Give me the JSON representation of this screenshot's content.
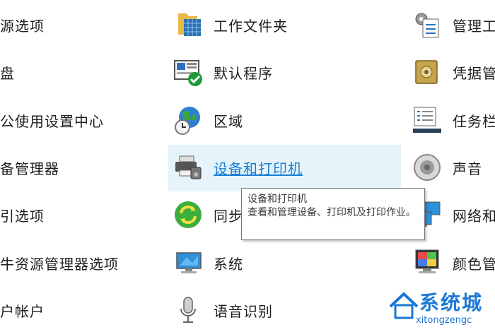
{
  "col1": [
    {
      "label": "源选项"
    },
    {
      "label": "盘"
    },
    {
      "label": "公使用设置中心"
    },
    {
      "label": "备管理器"
    },
    {
      "label": "引选项"
    },
    {
      "label": "牛资源管理器选项"
    },
    {
      "label": "户帐户"
    }
  ],
  "col2": [
    {
      "label": "工作文件夹",
      "icon": "work-folders-icon"
    },
    {
      "label": "默认程序",
      "icon": "default-programs-icon"
    },
    {
      "label": "区域",
      "icon": "region-icon"
    },
    {
      "label": "设备和打印机",
      "icon": "printer-icon"
    },
    {
      "label": "同步",
      "icon": "sync-center-icon"
    },
    {
      "label": "系统",
      "icon": "system-icon"
    },
    {
      "label": "语音识别",
      "icon": "microphone-icon"
    }
  ],
  "col3": [
    {
      "label": "管理工",
      "icon": "admin-tools-icon"
    },
    {
      "label": "凭据管",
      "icon": "credential-manager-icon"
    },
    {
      "label": "任务栏",
      "icon": "taskbar-icon"
    },
    {
      "label": "声音",
      "icon": "speaker-icon"
    },
    {
      "label": "网络和",
      "icon": "network-icon"
    },
    {
      "label": "颜色管",
      "icon": "color-management-icon"
    }
  ],
  "tooltip": {
    "title": "设备和打印机",
    "desc": "查看和管理设备、打印机及打印作业。"
  },
  "watermark": {
    "text": "系统城",
    "url": "xitongzengc"
  },
  "colors": {
    "hover": "#e5f3fb",
    "link": "#1a7fd4",
    "brand": "#1c78d4"
  }
}
